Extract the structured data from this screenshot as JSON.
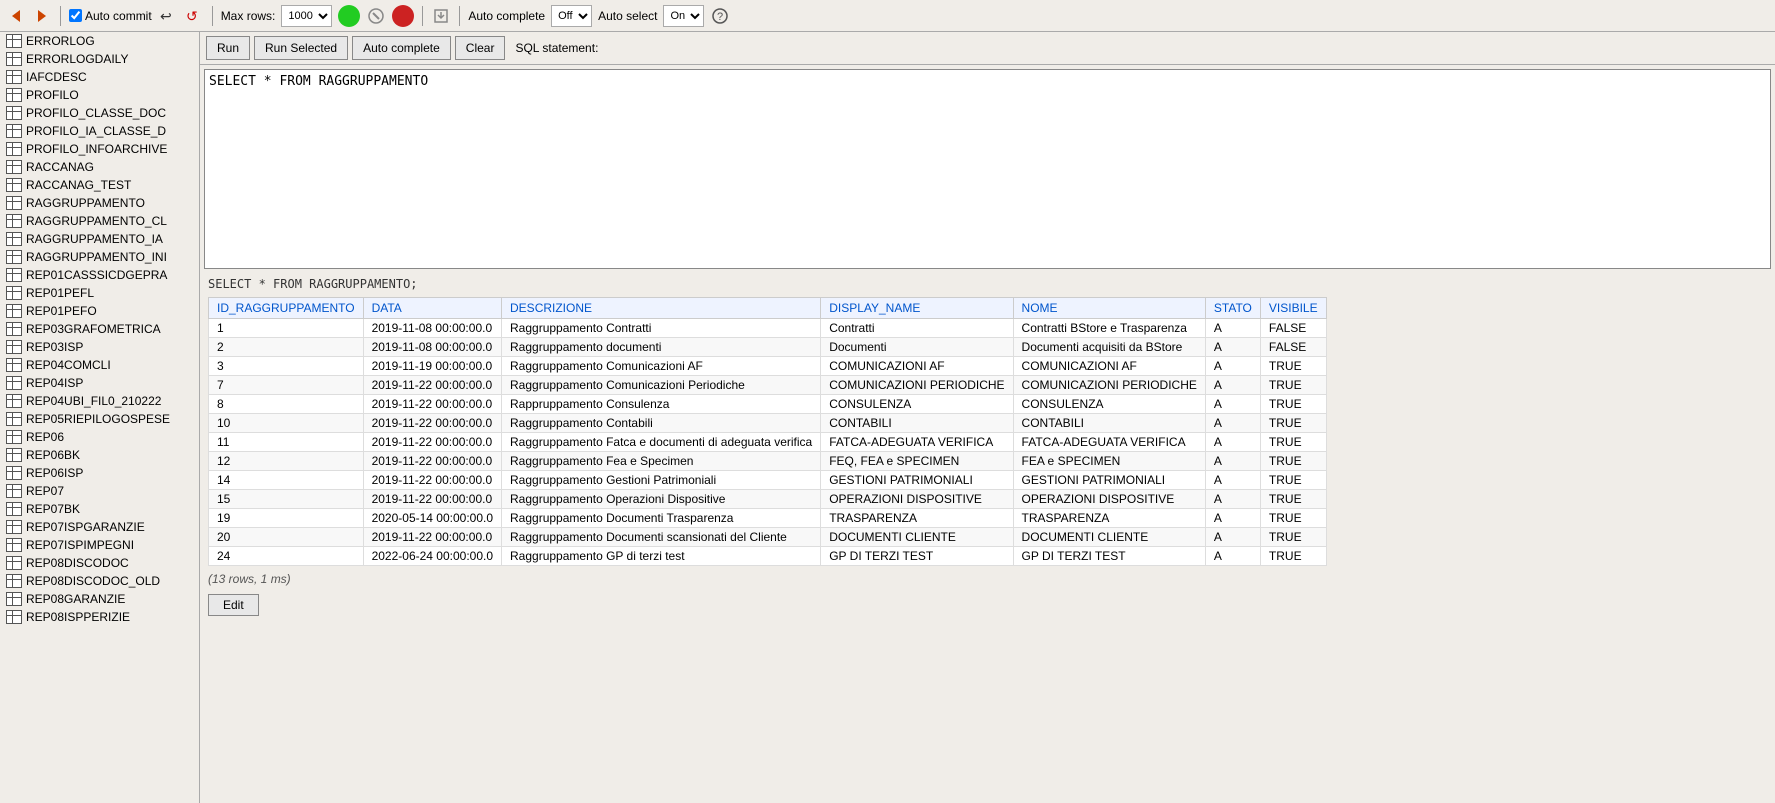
{
  "toolbar": {
    "auto_commit_label": "Auto commit",
    "max_rows_label": "Max rows:",
    "max_rows_value": "1000",
    "auto_complete_label": "Auto complete",
    "auto_complete_value": "Off",
    "auto_select_label": "Auto select",
    "auto_select_value": "On"
  },
  "sql_toolbar": {
    "run_label": "Run",
    "run_selected_label": "Run Selected",
    "auto_complete_label": "Auto complete",
    "clear_label": "Clear",
    "sql_statement_label": "SQL statement:"
  },
  "editor": {
    "query": "SELECT * FROM RAGGRUPPAMENTO"
  },
  "results": {
    "query_display": "SELECT * FROM RAGGRUPPAMENTO;",
    "columns": [
      "ID_RAGGRUPPAMENTO",
      "DATA",
      "DESCRIZIONE",
      "DISPLAY_NAME",
      "NOME",
      "STATO",
      "VISIBILE"
    ],
    "rows": [
      [
        "1",
        "2019-11-08 00:00:00.0",
        "Raggruppamento Contratti",
        "Contratti",
        "Contratti BStore e Trasparenza",
        "A",
        "FALSE"
      ],
      [
        "2",
        "2019-11-08 00:00:00.0",
        "Raggruppamento documenti",
        "Documenti",
        "Documenti acquisiti da BStore",
        "A",
        "FALSE"
      ],
      [
        "3",
        "2019-11-19 00:00:00.0",
        "Raggruppamento Comunicazioni AF",
        "COMUNICAZIONI AF",
        "COMUNICAZIONI AF",
        "A",
        "TRUE"
      ],
      [
        "7",
        "2019-11-22 00:00:00.0",
        "Raggruppamento Comunicazioni Periodiche",
        "COMUNICAZIONI PERIODICHE",
        "COMUNICAZIONI PERIODICHE",
        "A",
        "TRUE"
      ],
      [
        "8",
        "2019-11-22 00:00:00.0",
        "Rappruppamento Consulenza",
        "CONSULENZA",
        "CONSULENZA",
        "A",
        "TRUE"
      ],
      [
        "10",
        "2019-11-22 00:00:00.0",
        "Raggruppamento Contabili",
        "CONTABILI",
        "CONTABILI",
        "A",
        "TRUE"
      ],
      [
        "11",
        "2019-11-22 00:00:00.0",
        "Raggruppamento Fatca e documenti di adeguata verifica",
        "FATCA-ADEGUATA VERIFICA",
        "FATCA-ADEGUATA VERIFICA",
        "A",
        "TRUE"
      ],
      [
        "12",
        "2019-11-22 00:00:00.0",
        "Raggruppamento Fea e Specimen",
        "FEQ, FEA e SPECIMEN",
        "FEA e SPECIMEN",
        "A",
        "TRUE"
      ],
      [
        "14",
        "2019-11-22 00:00:00.0",
        "Raggruppamento Gestioni Patrimoniali",
        "GESTIONI PATRIMONIALI",
        "GESTIONI PATRIMONIALI",
        "A",
        "TRUE"
      ],
      [
        "15",
        "2019-11-22 00:00:00.0",
        "Raggruppamento Operazioni Dispositive",
        "OPERAZIONI DISPOSITIVE",
        "OPERAZIONI DISPOSITIVE",
        "A",
        "TRUE"
      ],
      [
        "19",
        "2020-05-14 00:00:00.0",
        "Raggruppamento Documenti Trasparenza",
        "TRASPARENZA",
        "TRASPARENZA",
        "A",
        "TRUE"
      ],
      [
        "20",
        "2019-11-22 00:00:00.0",
        "Raggruppamento Documenti scansionati del Cliente",
        "DOCUMENTI CLIENTE",
        "DOCUMENTI CLIENTE",
        "A",
        "TRUE"
      ],
      [
        "24",
        "2022-06-24 00:00:00.0",
        "Raggruppamento GP di terzi test",
        "GP DI TERZI TEST",
        "GP DI TERZI TEST",
        "A",
        "TRUE"
      ]
    ],
    "footer": "(13 rows, 1 ms)",
    "edit_label": "Edit"
  },
  "sidebar": {
    "items": [
      "ERRORLOG",
      "ERRORLOGDAILY",
      "IAFCDESC",
      "PROFILO",
      "PROFILO_CLASSE_DOC",
      "PROFILO_IA_CLASSE_D",
      "PROFILO_INFOARCHIVE",
      "RACCANAG",
      "RACCANAG_TEST",
      "RAGGRUPPAMENTO",
      "RAGGRUPPAMENTO_CL",
      "RAGGRUPPAMENTO_IA",
      "RAGGRUPPAMENTO_INI",
      "REP01CASSSICDGEPRA",
      "REP01PEFL",
      "REP01PEFO",
      "REP03GRAFOMETRICA",
      "REP03ISP",
      "REP04COMCLI",
      "REP04ISP",
      "REP04UBI_FIL0_210222",
      "REP05RIEPILOGOSPESE",
      "REP06",
      "REP06BK",
      "REP06ISP",
      "REP07",
      "REP07BK",
      "REP07ISPGARANZIE",
      "REP07ISPIMPEGNI",
      "REP08DISCODOC",
      "REP08DISCODOC_OLD",
      "REP08GARANZIE",
      "REP08ISPPERIZIE"
    ]
  }
}
